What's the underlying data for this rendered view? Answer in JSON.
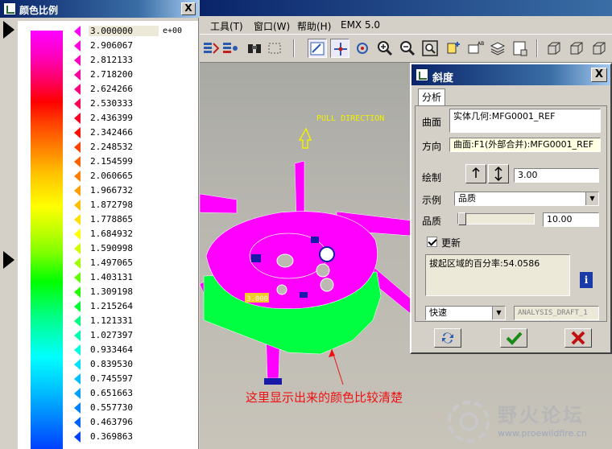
{
  "scale_window": {
    "title": "颜色比例",
    "close_label": "X",
    "exponent": "e+00",
    "values": [
      "3.000000",
      "2.906067",
      "2.812133",
      "2.718200",
      "2.624266",
      "2.530333",
      "2.436399",
      "2.342466",
      "2.248532",
      "2.154599",
      "2.060665",
      "1.966732",
      "1.872798",
      "1.778865",
      "1.684932",
      "1.590998",
      "1.497065",
      "1.403131",
      "1.309198",
      "1.215264",
      "1.121331",
      "1.027397",
      "0.933464",
      "0.839530",
      "0.745597",
      "0.651663",
      "0.557730",
      "0.463796",
      "0.369863"
    ],
    "marker_colors": [
      "#ff00ff",
      "#ff00e0",
      "#ff00c0",
      "#ff00a0",
      "#ff0080",
      "#ff0050",
      "#ff0020",
      "#ff1000",
      "#ff4000",
      "#ff6000",
      "#ff8000",
      "#ffa000",
      "#ffc000",
      "#ffe000",
      "#ffff00",
      "#d0ff00",
      "#a0ff00",
      "#60ff00",
      "#20ff00",
      "#00ff30",
      "#00ff80",
      "#00ffb0",
      "#00ffe0",
      "#00e0ff",
      "#00c0ff",
      "#00a0ff",
      "#0080ff",
      "#0060ff",
      "#0040ff"
    ]
  },
  "menu": {
    "items": [
      "工具(T)",
      "窗口(W)",
      "帮助(H)",
      "EMX 5.0"
    ]
  },
  "toolbar": {
    "icons": [
      "regenerate-icon",
      "regenerate-manager-icon",
      "binoculars-icon",
      "box-select-icon",
      "sketch-icon",
      "datum-axis-icon",
      "spin-center-icon",
      "zoom-in-icon",
      "zoom-out-icon",
      "refit-icon",
      "orient-icon",
      "saved-views-icon",
      "layers-icon",
      "model-tree-icon",
      "wireframe-icon",
      "hidden-line-icon",
      "no-hidden-icon"
    ]
  },
  "viewport": {
    "pull_direction": "PULL DIRECTION",
    "value_tag": "3.000"
  },
  "slope_dialog": {
    "title": "斜度",
    "close_label": "X",
    "tab": "分析",
    "surface_label": "曲面",
    "surface_value": "实体几何:MFG0001_REF",
    "direction_label": "方向",
    "direction_value": "曲面:F1(外部合并):MFG0001_REF",
    "draw_label": "绘制",
    "draw_value": "3.00",
    "example_label": "示例",
    "example_value": "品质",
    "quality_label": "品质",
    "quality_value": "10.00",
    "quality_slider": 0.0,
    "update_label": "更新",
    "result_text": "拔起区域的百分率:54.0586",
    "mode_value": "快速",
    "analysis_name": "ANALYSIS_DRAFT_1"
  },
  "annotation": "这里显示出来的颜色比较清楚",
  "watermark": {
    "text": "野火论坛",
    "url": "www.proewildfire.cn"
  },
  "colors": {
    "titlebar": "#0a246a",
    "annotation": "#ee1111",
    "magenta": "#ff00ff",
    "green": "#00ff40"
  }
}
